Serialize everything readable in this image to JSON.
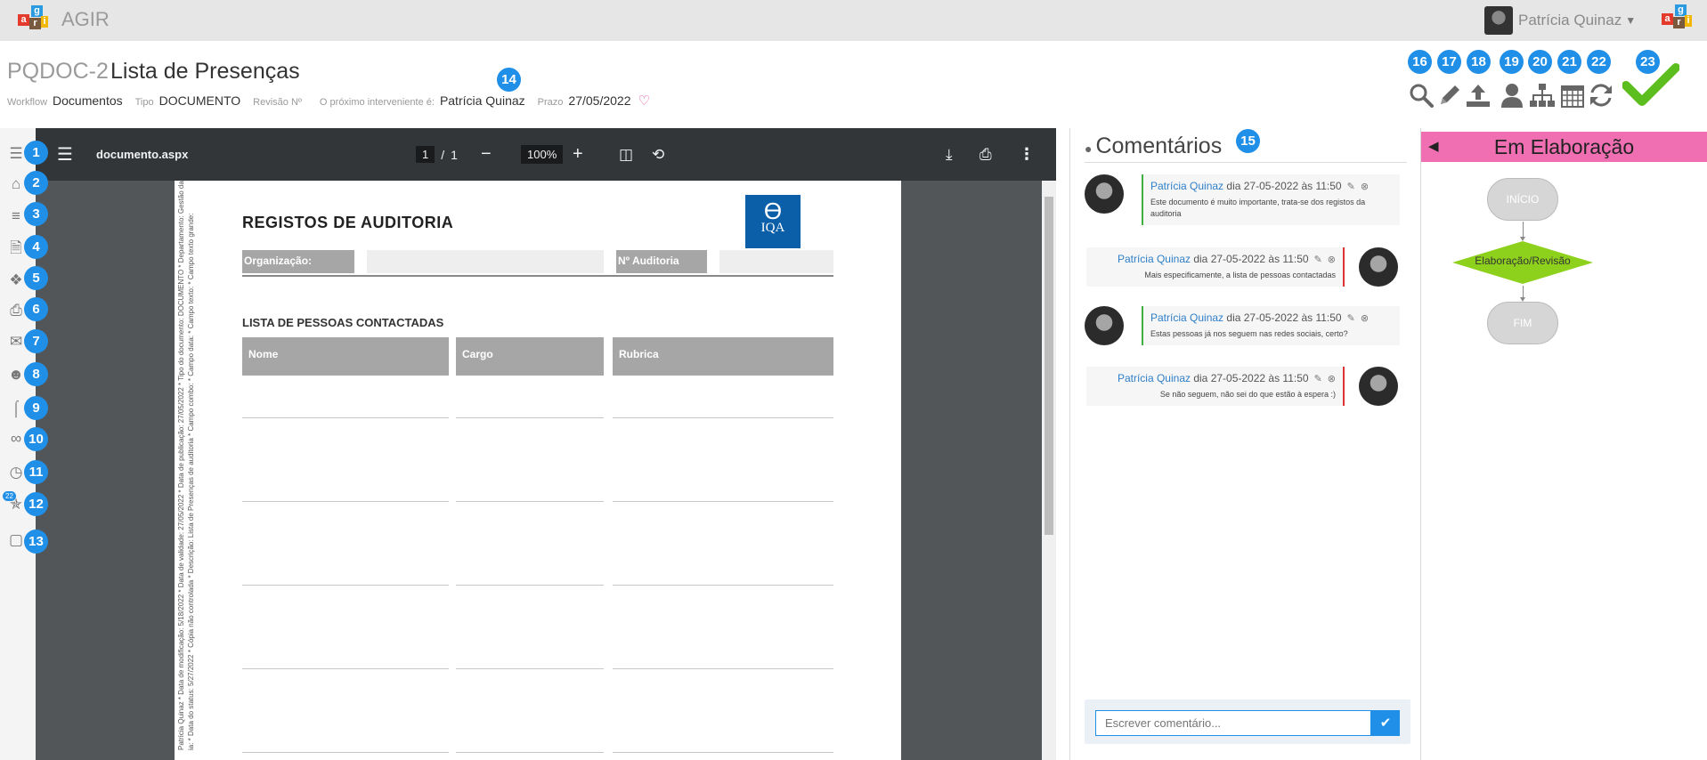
{
  "app": {
    "name": "AGIR",
    "logo_letters": [
      "a",
      "g",
      "r",
      "i"
    ]
  },
  "user": {
    "name": "Patrícia Quinaz"
  },
  "document": {
    "code": "PQDOC-2",
    "title": "Lista de Presenças",
    "meta": {
      "workflow_label": "Workflow",
      "workflow_value": "Documentos",
      "tipo_label": "Tipo",
      "tipo_value": "DOCUMENTO",
      "revisao_label": "Revisão Nº",
      "interveniente_label": "O próximo interveniente é:",
      "interveniente_value": "Patrícia Quinaz",
      "prazo_label": "Prazo",
      "prazo_value": "27/05/2022"
    }
  },
  "badges": [
    "1",
    "2",
    "3",
    "4",
    "5",
    "6",
    "7",
    "8",
    "9",
    "10",
    "11",
    "12",
    "13",
    "14",
    "15",
    "16",
    "17",
    "18",
    "19",
    "20",
    "21",
    "22",
    "23"
  ],
  "sidebar": {
    "icons": [
      "menu-icon",
      "home-icon",
      "list-icon",
      "document-icon",
      "tags-icon",
      "print-icon",
      "mail-icon",
      "users-icon",
      "attachment-icon",
      "link-icon",
      "clock-icon",
      "history-icon",
      "archive-icon"
    ],
    "history_count": "22"
  },
  "toolbar": {
    "tools": [
      "search-icon",
      "edit-icon",
      "upload-icon",
      "user-icon",
      "sitemap-icon",
      "calendar-icon",
      "refresh-icon",
      "approve-check-icon"
    ]
  },
  "viewer": {
    "filename": "documento.aspx",
    "page_current": "1",
    "page_sep": "/",
    "page_total": "1",
    "zoom": "100%",
    "pdf": {
      "heading": "REGISTOS DE AUDITORIA",
      "logo_text": "IQA",
      "org_label": "Organização:",
      "audit_label": "Nº Auditoria",
      "section": "LISTA DE PESSOAS CONTACTADAS",
      "col_nome": "Nome",
      "col_cargo": "Cargo",
      "col_rubrica": "Rubrica",
      "side_text_1": "Patrícia Quinaz * Data de modificação: 5/18/2022 * Data de validade: 27/05/2022 * Data de publicação: 27/05/2022 * Tipo do documento: DOCUMENTO * Departamento: Gestão da",
      "side_text_2": "ia: * Data do status: 5/27/2022 * Cópia não controlada * Descrição: Lista de Presenças de auditoria * Campo combo: * Campo data: * Campo texto: * Campo texto grande:"
    }
  },
  "comments": {
    "title": "Comentários",
    "items": [
      {
        "author": "Patrícia Quinaz",
        "date": "dia 27-05-2022 às 11:50",
        "text": "Este documento é muito importante, trata-se dos registos da auditoria",
        "side": "left"
      },
      {
        "author": "Patrícia Quinaz",
        "date": "dia 27-05-2022 às 11:50",
        "text": "Mais especificamente, a lista de pessoas contactadas",
        "side": "right"
      },
      {
        "author": "Patrícia Quinaz",
        "date": "dia 27-05-2022 às 11:50",
        "text": "Estas pessoas já nos seguem nas redes sociais, certo?",
        "side": "left"
      },
      {
        "author": "Patrícia Quinaz",
        "date": "dia 27-05-2022 às 11:50",
        "text": "Se não seguem, não sei do que estão à espera :)",
        "side": "right"
      }
    ],
    "input_placeholder": "Escrever comentário..."
  },
  "workflow": {
    "state": "Em Elaboração",
    "nodes": {
      "start": "INÍCIO",
      "step": "Elaboração/Revisão",
      "end": "FIM"
    }
  },
  "colors": {
    "accent": "#1f8fe8",
    "approve": "#5cbd1f",
    "state_header": "#f06fb2",
    "diamond": "#8ed11d"
  }
}
